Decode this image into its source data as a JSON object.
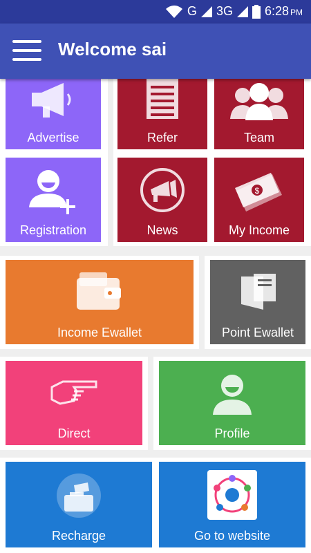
{
  "status_bar": {
    "network_g": "G",
    "network_3g": "3G",
    "time": "6:28",
    "ampm": "PM"
  },
  "app_bar": {
    "title": "Welcome sai"
  },
  "tiles": {
    "advertise": "Advertise",
    "registration": "Registration",
    "refer": "Refer",
    "team": "Team",
    "news": "News",
    "my_income": "My Income",
    "income_ewallet": "Income Ewallet",
    "point_ewallet": "Point Ewallet",
    "direct": "Direct",
    "profile": "Profile",
    "recharge": "Recharge",
    "go_to_website": "Go to website"
  }
}
